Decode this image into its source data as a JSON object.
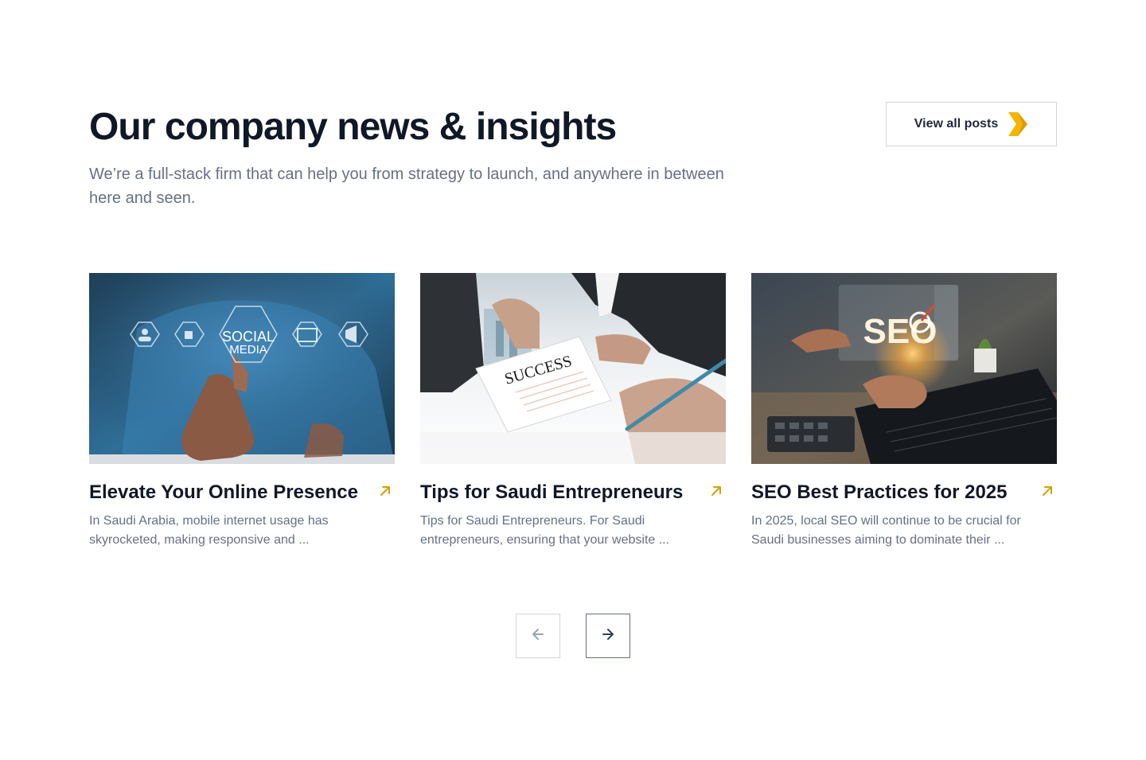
{
  "header": {
    "title": "Our company news & insights",
    "subtitle": "We’re a full-stack firm that can help you from strategy to launch, and anywhere in between here and seen.",
    "view_all_label": "View all posts",
    "view_all_icon": "chevron-right-icon"
  },
  "posts": [
    {
      "title": "Elevate Your Online Presence",
      "excerpt": "In Saudi Arabia, mobile internet usage has skyrocketed, making responsive and ...",
      "image": {
        "alt": "social-media-hand-image",
        "overlay_text_1": "SOCIAL",
        "overlay_text_2": "MEDIA"
      },
      "arrow_icon": "arrow-up-right-icon"
    },
    {
      "title": "Tips for Saudi Entrepreneurs",
      "excerpt": "Tips for Saudi Entrepreneurs. For Saudi entrepreneurs, ensuring that your website ...",
      "image": {
        "alt": "success-document-image",
        "overlay_text_1": "SUCCESS"
      },
      "arrow_icon": "arrow-up-right-icon"
    },
    {
      "title": "SEO Best Practices for 2025",
      "excerpt": "In 2025, local SEO will continue to be crucial for Saudi businesses aiming to dominate their ...",
      "image": {
        "alt": "seo-laptop-image",
        "overlay_text_1": "SEO"
      },
      "arrow_icon": "arrow-up-right-icon"
    }
  ],
  "pager": {
    "prev_icon": "arrow-left-icon",
    "next_icon": "arrow-right-icon"
  },
  "colors": {
    "accent": "#f5b400",
    "arrow_accent": "#d4a106",
    "heading": "#101828",
    "body": "#667085",
    "border": "#d0d5dd"
  }
}
